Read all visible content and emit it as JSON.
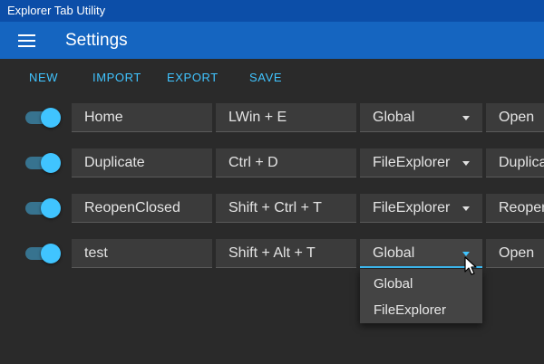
{
  "window": {
    "title": "Explorer Tab Utility"
  },
  "appbar": {
    "menu_icon": "hamburger-menu-icon",
    "title": "Settings"
  },
  "toolbar": {
    "new_label": "NEW",
    "import_label": "IMPORT",
    "export_label": "EXPORT",
    "save_label": "SAVE"
  },
  "hotkeys": [
    {
      "enabled": true,
      "name": "Home",
      "keys": "LWin + E",
      "scope": "Global",
      "action": "Open"
    },
    {
      "enabled": true,
      "name": "Duplicate",
      "keys": "Ctrl + D",
      "scope": "FileExplorer",
      "action": "Duplicate"
    },
    {
      "enabled": true,
      "name": "ReopenClosed",
      "keys": "Shift + Ctrl + T",
      "scope": "FileExplorer",
      "action": "Reopen"
    },
    {
      "enabled": true,
      "name": "test",
      "keys": "Shift + Alt + T",
      "scope": "Global",
      "action": "Open"
    }
  ],
  "scope_dropdown": {
    "options": [
      "Global",
      "FileExplorer"
    ]
  },
  "colors": {
    "titlebar": "#0c4ea8",
    "appbar": "#1565c0",
    "accent": "#40c4ff",
    "background": "#2a2a2a",
    "field": "#3b3b3b"
  },
  "icons": {
    "menu": "hamburger-menu-icon",
    "dropdown_caret": "caret-down-icon",
    "pointer": "mouse-pointer-icon"
  }
}
